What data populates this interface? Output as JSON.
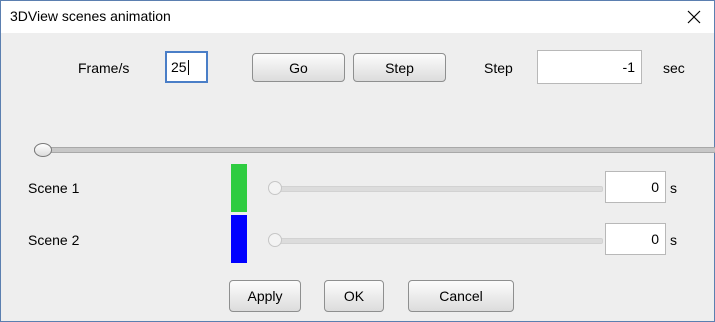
{
  "dialog": {
    "title": "3DView scenes animation"
  },
  "toolbar": {
    "fps_label": "Frame/s",
    "fps_value": "25",
    "go_label": "Go",
    "step_button_label": "Step",
    "step_label": "Step",
    "step_value": "-1",
    "step_unit": "sec"
  },
  "timeline": {
    "position": 0
  },
  "scenes": [
    {
      "label": "Scene 1",
      "color": "#2ecc40",
      "slider_position": 0,
      "value": "0",
      "unit": "s"
    },
    {
      "label": "Scene 2",
      "color": "#0000ff",
      "slider_position": 0,
      "value": "0",
      "unit": "s"
    }
  ],
  "footer": {
    "apply_label": "Apply",
    "ok_label": "OK",
    "cancel_label": "Cancel"
  },
  "icons": {
    "close": "close-icon"
  }
}
